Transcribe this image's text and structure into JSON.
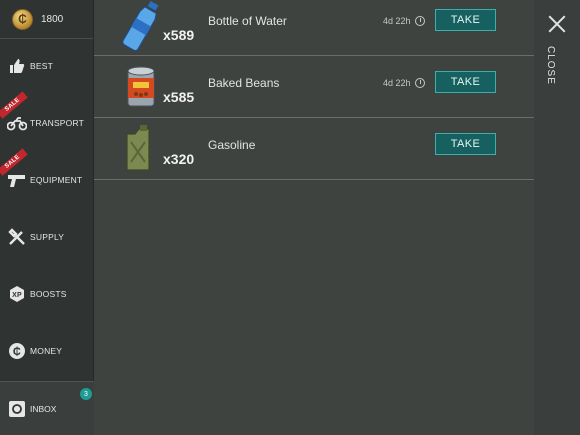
{
  "wallet": {
    "coins": "1800",
    "coin_symbol": "₵"
  },
  "sidebar": {
    "items": [
      {
        "label": "BEST",
        "icon": "thumbs-up-icon",
        "sale": false
      },
      {
        "label": "TRANSPORT",
        "icon": "motorcycle-icon",
        "sale": true,
        "sale_label": "SALE"
      },
      {
        "label": "EQUIPMENT",
        "icon": "pistol-icon",
        "sale": true,
        "sale_label": "SALE"
      },
      {
        "label": "SUPPLY",
        "icon": "tools-icon",
        "sale": false
      },
      {
        "label": "BOOSTS",
        "icon": "xp-icon",
        "sale": false
      },
      {
        "label": "MONEY",
        "icon": "coin-icon",
        "sale": false
      }
    ],
    "inbox": {
      "label": "INBOX",
      "badge": "3",
      "icon": "safe-icon"
    }
  },
  "items": [
    {
      "qty": "x589",
      "name": "Bottle of Water",
      "timer": "4d 22h",
      "action": "TAKE",
      "icon": "water-bottle-icon"
    },
    {
      "qty": "x585",
      "name": "Baked Beans",
      "timer": "4d 22h",
      "action": "TAKE",
      "icon": "bean-can-icon"
    },
    {
      "qty": "x320",
      "name": "Gasoline",
      "timer": "",
      "action": "TAKE",
      "icon": "jerrycan-icon"
    }
  ],
  "close": {
    "label": "CLOSE"
  },
  "colors": {
    "accent": "#16605f",
    "accent_border": "#3bb0aa",
    "sale": "#c1272d",
    "badge": "#1f9c95"
  }
}
